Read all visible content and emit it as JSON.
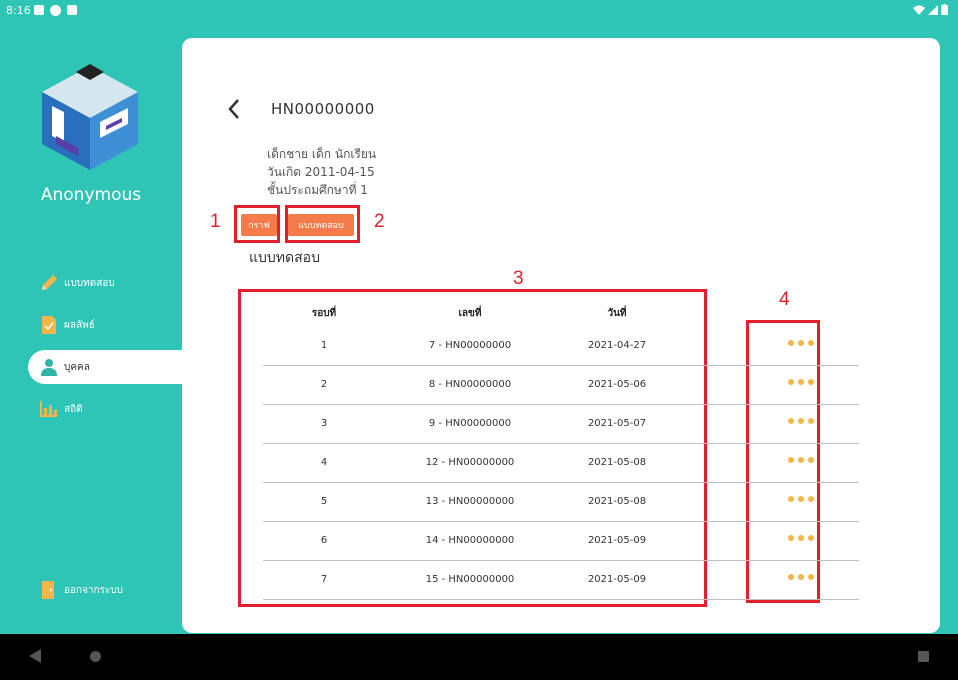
{
  "status_bar": {
    "time": "8:16"
  },
  "sidebar": {
    "app_name": "Anonymous",
    "items": [
      {
        "label": "แบบทดสอบ",
        "icon": "pencil-icon"
      },
      {
        "label": "ผลลัพธ์",
        "icon": "document-icon"
      },
      {
        "label": "บุคคล",
        "icon": "person-icon"
      },
      {
        "label": "สถิติ",
        "icon": "bar-chart-icon"
      }
    ],
    "logout_label": "ออกจากระบบ"
  },
  "header": {
    "patient_id": "HN00000000"
  },
  "patient_info": {
    "name": "เด็กชาย เด็ก นักเรียน",
    "birthdate": "วันเกิด 2011-04-15",
    "grade": "ชั้นประถมศึกษาที่ 1"
  },
  "buttons": {
    "graph": "กราฟ",
    "test": "แบบทดสอบ"
  },
  "section_title": "แบบทดสอบ",
  "table": {
    "headers": [
      "รอบที่",
      "เลขที่",
      "วันที่"
    ],
    "rows": [
      {
        "round": "1",
        "number": "7 - HN00000000",
        "date": "2021-04-27"
      },
      {
        "round": "2",
        "number": "8 - HN00000000",
        "date": "2021-05-06"
      },
      {
        "round": "3",
        "number": "9 - HN00000000",
        "date": "2021-05-07"
      },
      {
        "round": "4",
        "number": "12 - HN00000000",
        "date": "2021-05-08"
      },
      {
        "round": "5",
        "number": "13 - HN00000000",
        "date": "2021-05-08"
      },
      {
        "round": "6",
        "number": "14 - HN00000000",
        "date": "2021-05-09"
      },
      {
        "round": "7",
        "number": "15 - HN00000000",
        "date": "2021-05-09"
      }
    ]
  },
  "annotations": [
    "1",
    "2",
    "3",
    "4"
  ],
  "colors": {
    "background": "#2ec5b6",
    "button": "#f47c4a",
    "dots": "#f5b54a",
    "annotation": "#e0202a"
  }
}
